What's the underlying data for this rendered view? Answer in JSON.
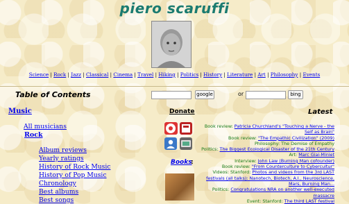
{
  "header": {
    "title": "piero scaruffi"
  },
  "topnav": [
    "Science",
    "Rock",
    "Jazz",
    "Classical",
    "Cinema",
    "Travel",
    "Hiking",
    "Politics",
    "History",
    "Literature",
    "Art",
    "Philosophy",
    "Events"
  ],
  "toc": "Table of Contents",
  "search": {
    "google_label": "google",
    "or_text": "or",
    "bing_label": "bing"
  },
  "donate": "Donate",
  "books": "Books",
  "latest": "Latest",
  "music": {
    "heading": "Music",
    "all_musicians": "All musicians",
    "rock": "Rock",
    "items": [
      "Album reviews",
      "Yearly ratings",
      "History of Rock Music",
      "History of Pop Music",
      "Chronology",
      "Best albums",
      "Best songs"
    ]
  },
  "latest_items": [
    {
      "prefix": "Book review: ",
      "link": "Patricia Churchland's \"Touching a Nerve - the Self as Brain\""
    },
    {
      "prefix": "Book review: ",
      "link": "\"The Empathic Civilization\" (2009)"
    },
    {
      "prefix": "Philosophy: ",
      "text": "The Demise of Empathy"
    },
    {
      "prefix": "Politics: ",
      "link": "The Biggest Ecological Disaster of the 21th Century"
    },
    {
      "prefix": "Art: ",
      "link": "Marc Giai-Miniet"
    },
    {
      "prefix": "Interview: ",
      "link": "John Law (Burning Man cofounder)"
    },
    {
      "prefix": "Book review: ",
      "link": "\"From Counterculture to Cybercultur\""
    },
    {
      "prefix": "Videos: Stanford: ",
      "link": "Photos and videos from the 3rd LAST festivals (all talks): Nanotech, Biotech, A.I., Neuroscience, Mars, Burning Man..."
    },
    {
      "prefix": "Politics: ",
      "link": "Congratulations NRA on another well-executed massacre"
    },
    {
      "prefix": "Event: Stanford: ",
      "link": "The third LAST festival"
    }
  ]
}
